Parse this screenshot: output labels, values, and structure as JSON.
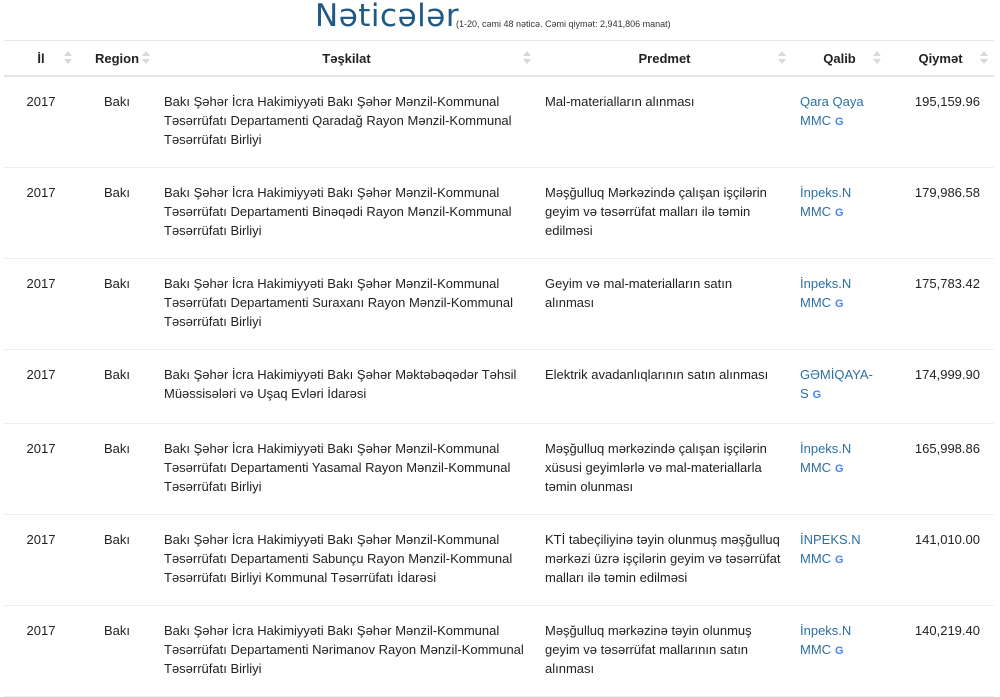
{
  "header": {
    "title": "Nəticələr",
    "summary": "(1-20, cəmi 48 nəticə. Cəmi qiymət: 2,941,806 manat)"
  },
  "table": {
    "columns": [
      "İl",
      "Region",
      "Təşkilat",
      "Predmet",
      "Qalib",
      "Qiymət"
    ],
    "google_icon_glyph": "G",
    "rows": [
      {
        "year": "2017",
        "region": "Bakı",
        "org": "Bakı Şəhər İcra Hakimiyyəti Bakı Şəhər Mənzil-Kommunal Təsərrüfatı Departamenti Qaradağ Rayon Mənzil-Kommunal Təsərrüfatı Birliyi",
        "subject": "Mal-materialların alınması",
        "winner": "Qara Qaya MMC",
        "price": "195,159.96"
      },
      {
        "year": "2017",
        "region": "Bakı",
        "org": "Bakı Şəhər İcra Hakimiyyəti Bakı Şəhər Mənzil-Kommunal Təsərrüfatı Departamenti Binəqədi Rayon Mənzil-Kommunal Təsərrüfatı Birliyi",
        "subject": "Məşğulluq Mərkəzində çalışan işçilərin geyim və təsərrüfat malları ilə təmin edilməsi",
        "winner": "İnpeks.N MMC",
        "price": "179,986.58"
      },
      {
        "year": "2017",
        "region": "Bakı",
        "org": "Bakı Şəhər İcra Hakimiyyəti Bakı Şəhər Mənzil-Kommunal Təsərrüfatı Departamenti Suraxanı Rayon Mənzil-Kommunal Təsərrüfatı Birliyi",
        "subject": "Geyim və mal-materialların satın alınması",
        "winner": "İnpeks.N MMC",
        "price": "175,783.42"
      },
      {
        "year": "2017",
        "region": "Bakı",
        "org": "Bakı Şəhər İcra Hakimiyyəti Bakı Şəhər Məktəbəqədər Təhsil Müəssisələri və Uşaq Evləri İdarəsi",
        "subject": "Elektrik avadanlıqlarının satın alınması",
        "winner": "GƏMİQAYA-S",
        "price": "174,999.90"
      },
      {
        "year": "2017",
        "region": "Bakı",
        "org": "Bakı Şəhər İcra Hakimiyyəti Bakı Şəhər Mənzil-Kommunal Təsərrüfatı Departamenti Yasamal Rayon Mənzil-Kommunal Təsərrüfatı Birliyi",
        "subject": "Məşğulluq mərkəzində çalışan işçilərin xüsusi geyimlərlə və mal-materiallarla təmin olunması",
        "winner": "İnpeks.N MMC",
        "price": "165,998.86"
      },
      {
        "year": "2017",
        "region": "Bakı",
        "org": "Bakı Şəhər İcra Hakimiyyəti Bakı Şəhər Mənzil-Kommunal Təsərrüfatı Departamenti Sabunçu Rayon Mənzil-Kommunal Təsərrüfatı Birliyi Kommunal Təsərrüfatı İdarəsi",
        "subject": "KTİ tabeçiliyinə təyin olunmuş məşğulluq mərkəzi üzrə işçilərin geyim və təsərrüfat malları ilə təmin edilməsi",
        "winner": "İNPEKS.N MMC",
        "price": "141,010.00"
      },
      {
        "year": "2017",
        "region": "Bakı",
        "org": "Bakı Şəhər İcra Hakimiyyəti Bakı Şəhər Mənzil-Kommunal Təsərrüfatı Departamenti Nərimanov Rayon Mənzil-Kommunal Təsərrüfatı Birliyi",
        "subject": "Məşğulluq mərkəzinə təyin olunmuş geyim və təsərrüfat mallarının satın alınması",
        "winner": "İnpeks.N MMC",
        "price": "140,219.40"
      }
    ]
  }
}
